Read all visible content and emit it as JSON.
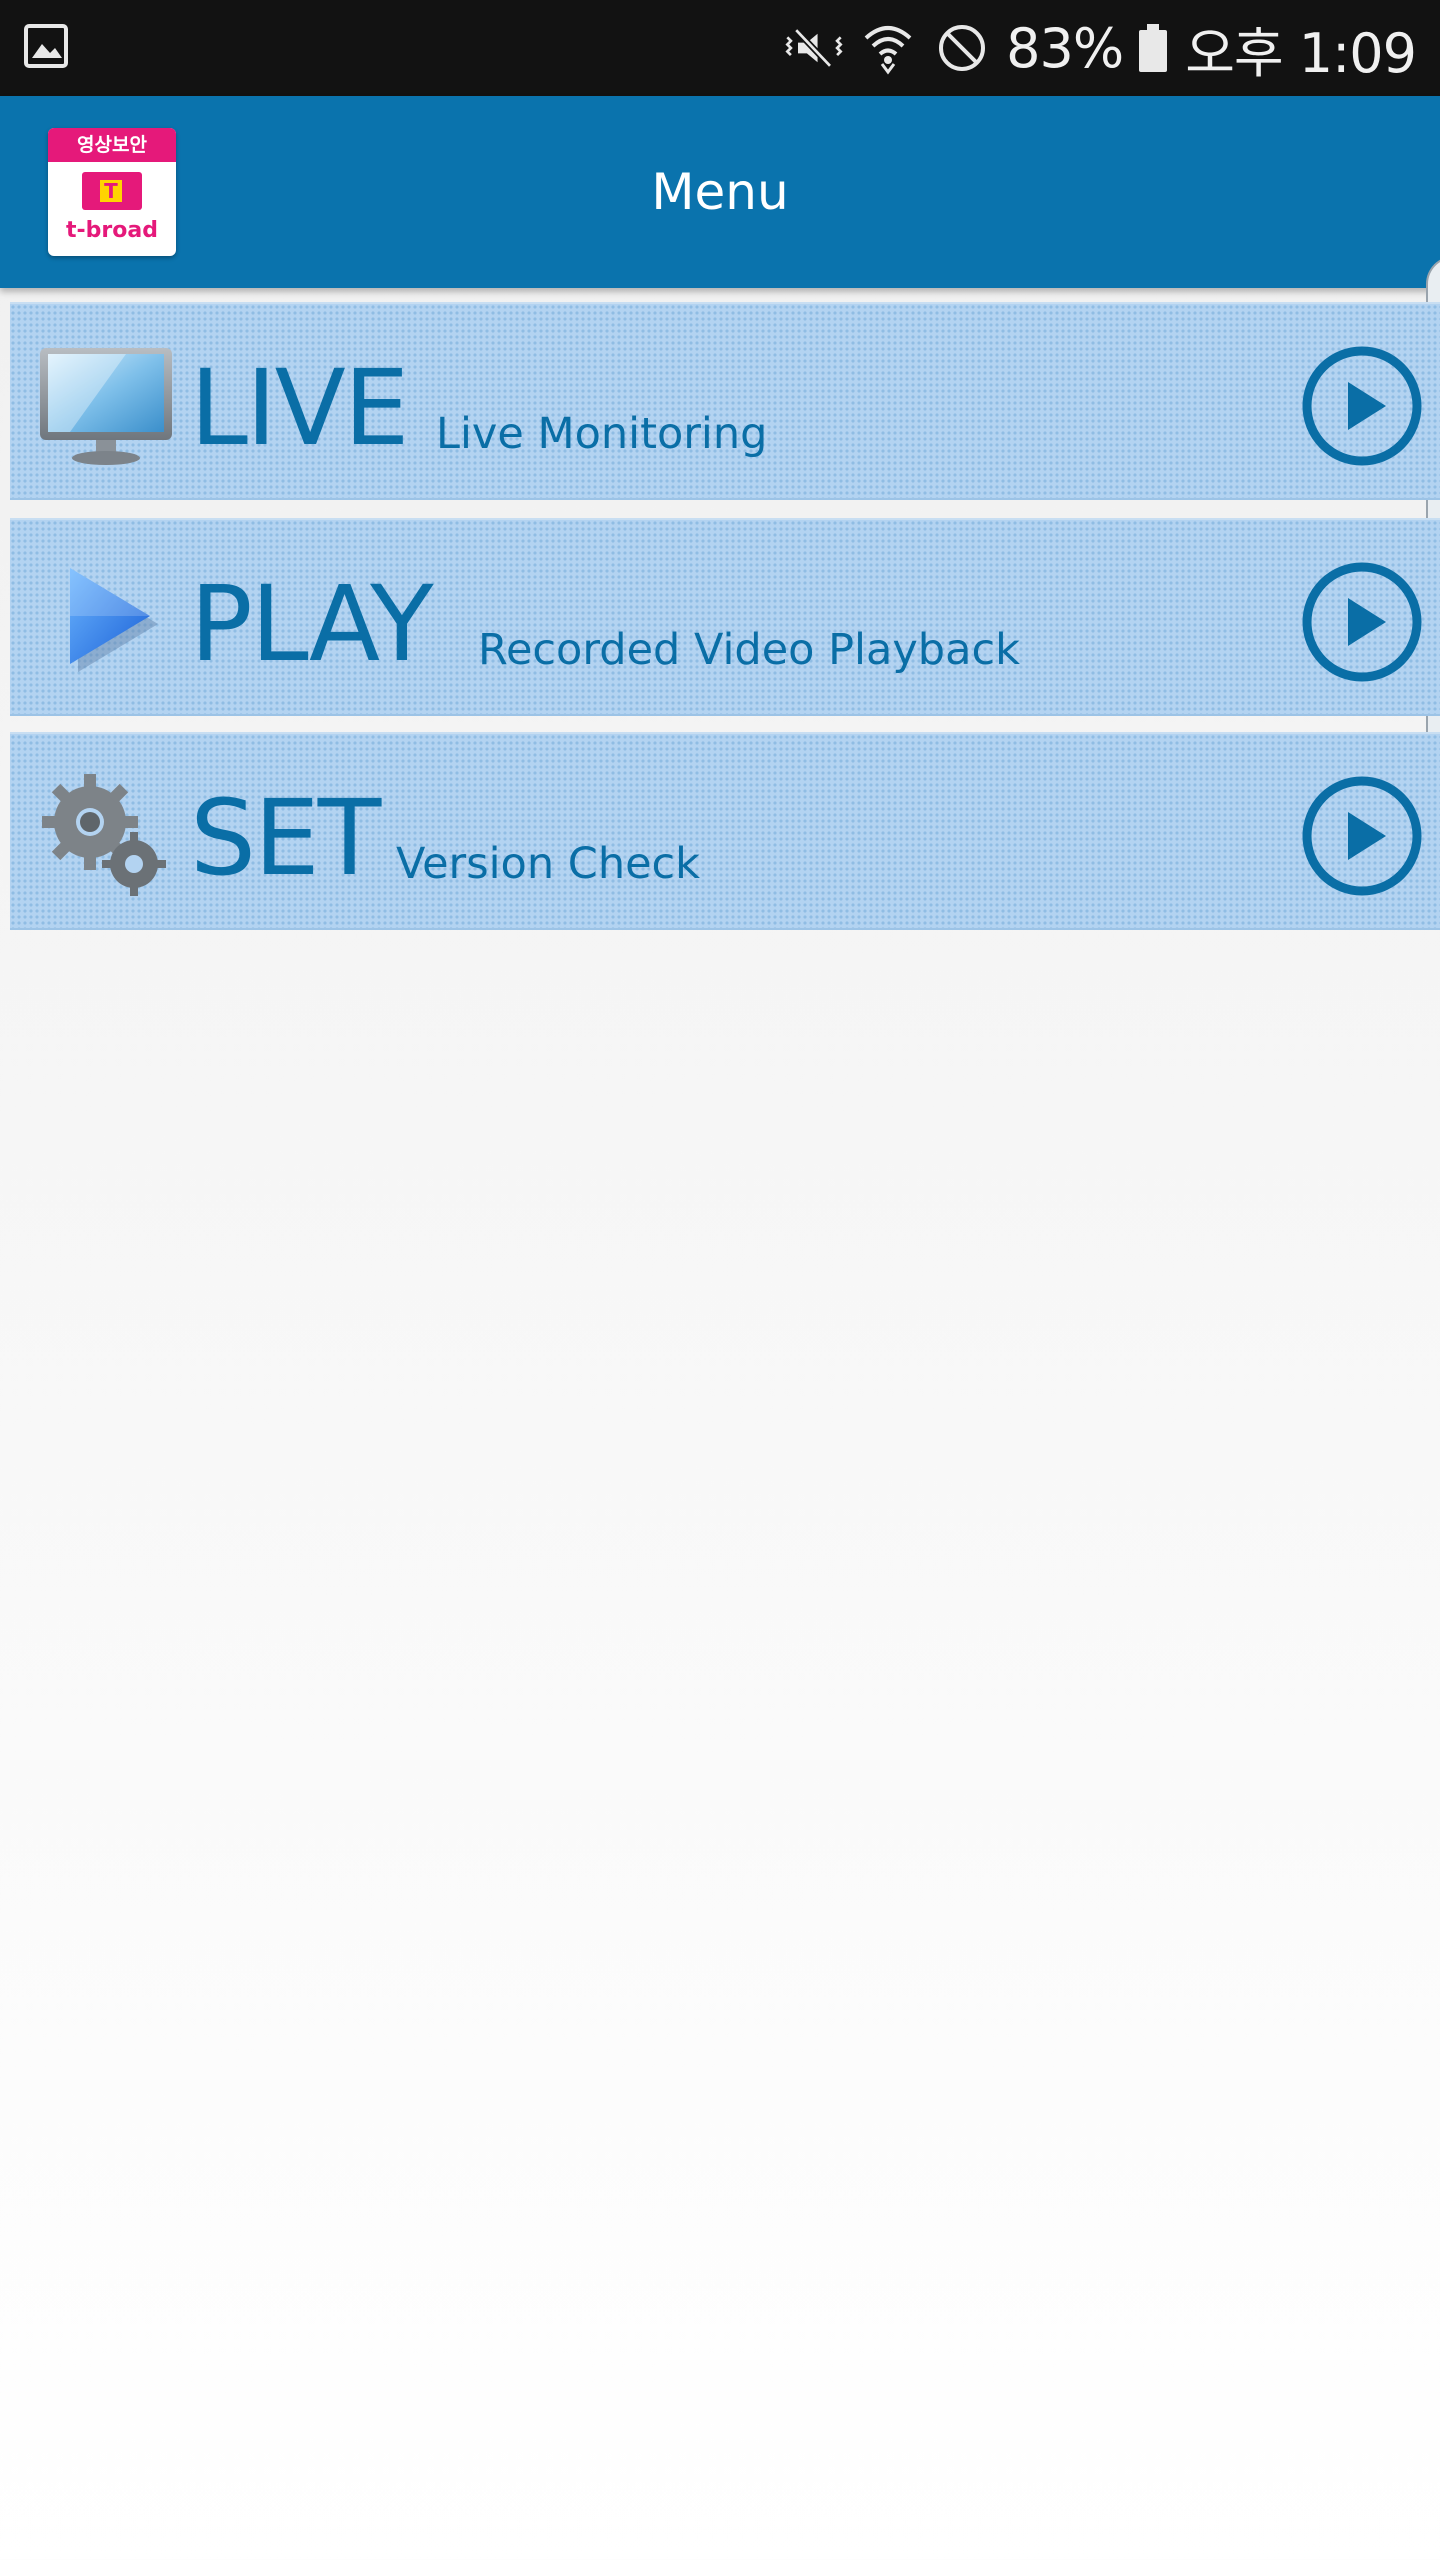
{
  "status_bar": {
    "battery": "83%",
    "time": "오후 1:09",
    "icons": [
      "gallery-icon",
      "mute-vibrate-icon",
      "wifi-icon",
      "no-disturb-icon",
      "battery-icon"
    ]
  },
  "header": {
    "title": "Menu",
    "logo": {
      "top_text": "영상보안",
      "mark_text": "T",
      "bottom_text": "t-broad",
      "brand_color": "#e5197a"
    }
  },
  "menu": {
    "items": [
      {
        "label": "LIVE",
        "subtitle": "Live Monitoring",
        "icon": "monitor-icon"
      },
      {
        "label": "PLAY",
        "subtitle": "Recorded Video Playback",
        "icon": "play-triangle-icon"
      },
      {
        "label": "SET",
        "subtitle": "Version Check",
        "icon": "gears-icon"
      }
    ]
  },
  "colors": {
    "status_bar": "#121212",
    "app_bar": "#0a73ad",
    "row_background": "#b3d3f1",
    "row_text": "#0a6ea6"
  }
}
